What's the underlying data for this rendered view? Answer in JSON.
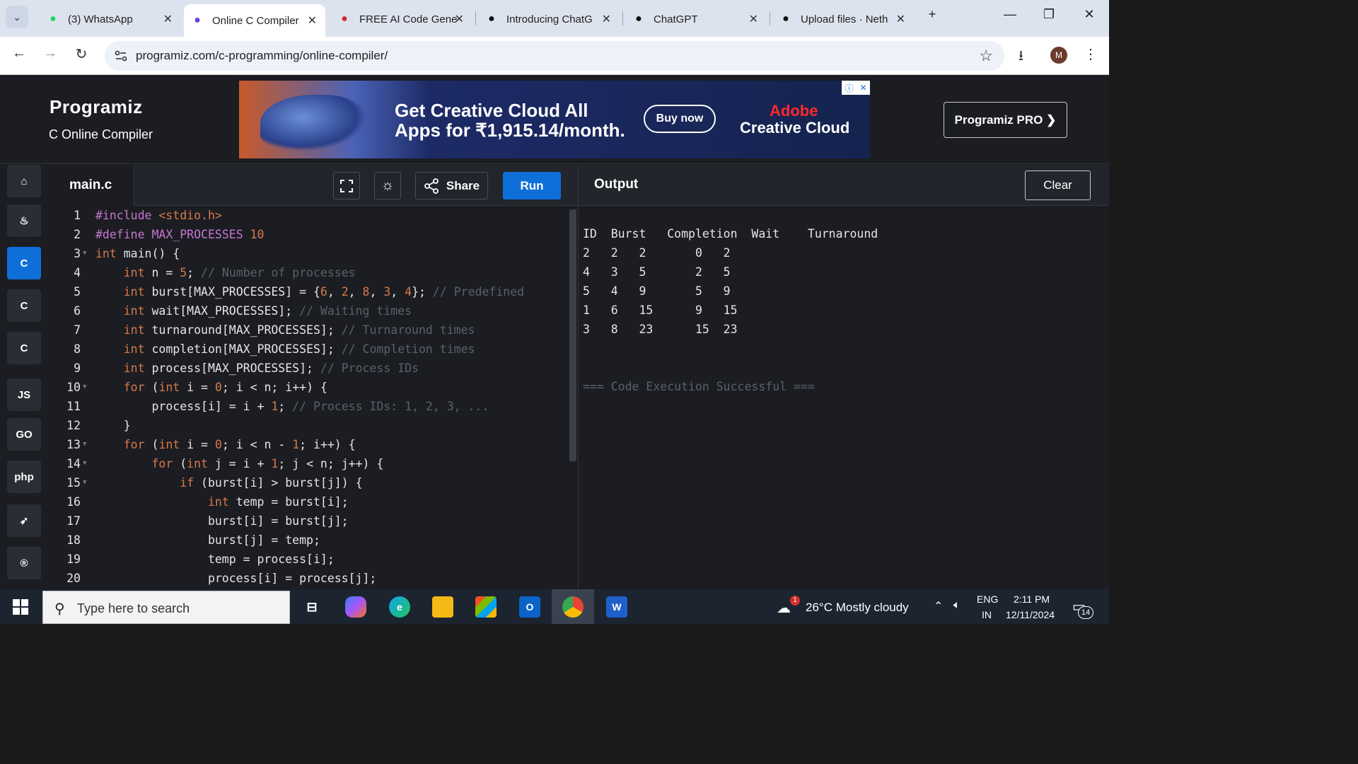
{
  "browser": {
    "tabs": [
      {
        "title": "(3) WhatsApp",
        "icon": "whatsapp-icon",
        "active": false
      },
      {
        "title": "Online C Compiler",
        "icon": "programiz-icon",
        "active": true
      },
      {
        "title": "FREE AI Code Gene",
        "icon": "code-gen-icon",
        "active": false
      },
      {
        "title": "Introducing ChatG",
        "icon": "openai-icon",
        "active": false
      },
      {
        "title": "ChatGPT",
        "icon": "chatgpt-icon",
        "active": false
      },
      {
        "title": "Upload files · Neth",
        "icon": "github-icon",
        "active": false
      }
    ],
    "url": "programiz.com/c-programming/online-compiler/",
    "profile_initial": "M"
  },
  "header": {
    "logo": "Programiz",
    "subtitle": "C Online Compiler",
    "pro_button": "Programiz PRO ❯"
  },
  "ad": {
    "headline": "Get Creative Cloud All Apps for ₹1,915.14/month.",
    "cta": "Buy now",
    "brand_line1": "Adobe",
    "brand_line2": "Creative Cloud"
  },
  "languages": [
    {
      "name": "html-icon",
      "label": "⌂",
      "active": false
    },
    {
      "name": "java-icon",
      "label": "♨",
      "active": false
    },
    {
      "name": "c-icon",
      "label": "C",
      "active": true
    },
    {
      "name": "cpp-icon",
      "label": "C",
      "active": false
    },
    {
      "name": "csharp-icon",
      "label": "C",
      "active": false
    },
    {
      "name": "js-icon",
      "label": "JS",
      "active": false
    },
    {
      "name": "go-icon",
      "label": "GO",
      "active": false
    },
    {
      "name": "php-icon",
      "label": "php",
      "active": false
    },
    {
      "name": "swift-icon",
      "label": "➶",
      "active": false
    },
    {
      "name": "rust-icon",
      "label": "®",
      "active": false
    }
  ],
  "editor": {
    "file_name": "main.c",
    "share_label": "Share",
    "run_label": "Run",
    "lines": [
      "#include <stdio.h>",
      "#define MAX_PROCESSES 10",
      "int main() {",
      "    int n = 5; // Number of processes",
      "    int burst[MAX_PROCESSES] = {6, 2, 8, 3, 4}; // Predefined",
      "    int wait[MAX_PROCESSES]; // Waiting times",
      "    int turnaround[MAX_PROCESSES]; // Turnaround times",
      "    int completion[MAX_PROCESSES]; // Completion times",
      "    int process[MAX_PROCESSES]; // Process IDs",
      "    for (int i = 0; i < n; i++) {",
      "        process[i] = i + 1; // Process IDs: 1, 2, 3, ...",
      "    }",
      "    for (int i = 0; i < n - 1; i++) {",
      "        for (int j = i + 1; j < n; j++) {",
      "            if (burst[i] > burst[j]) {",
      "                int temp = burst[i];",
      "                burst[i] = burst[j];",
      "                burst[j] = temp;",
      "                temp = process[i];",
      "                process[i] = process[j];"
    ],
    "folds": [
      3,
      10,
      13,
      14,
      15
    ]
  },
  "output": {
    "title": "Output",
    "clear_label": "Clear",
    "lines": [
      "ID  Burst   Completion  Wait    Turnaround",
      "2   2   2       0   2",
      "4   3   5       2   5",
      "5   4   9       5   9",
      "1   6   15      9   15",
      "3   8   23      15  23",
      "",
      "",
      "=== Code Execution Successful ==="
    ]
  },
  "taskbar": {
    "search_placeholder": "Type here to search",
    "weather": "26°C  Mostly cloudy",
    "weather_badge": "1",
    "lang": "ENG",
    "region": "IN",
    "time": "2:11 PM",
    "date": "12/11/2024",
    "notifications": "14"
  }
}
